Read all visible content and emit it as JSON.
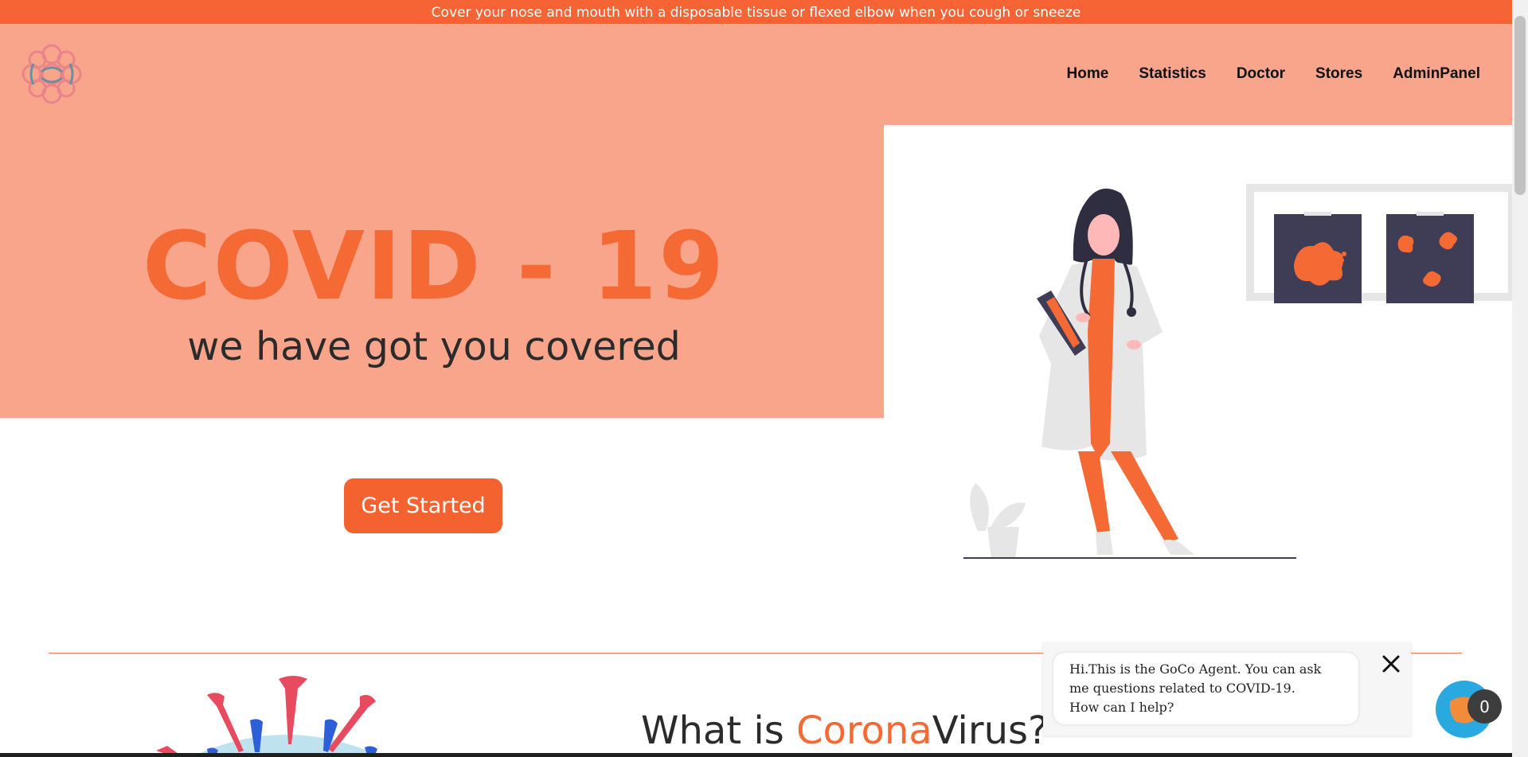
{
  "banner": {
    "text": "Cover your nose and mouth with a disposable tissue or flexed elbow when you cough or sneeze"
  },
  "header": {
    "logo_icon": "virus-logo-icon",
    "nav": [
      "Home",
      "Statistics",
      "Doctor",
      "Stores",
      "AdminPanel"
    ]
  },
  "hero": {
    "title": "COVID - 19",
    "subtitle": "we have got you covered",
    "cta_label": "Get Started"
  },
  "section": {
    "heading_prefix": "What is ",
    "heading_accent": "Corona",
    "heading_suffix": "Virus?"
  },
  "chat": {
    "lines": [
      "Hi.This is the GoCo Agent. You can ask",
      "me questions related to COVID-19.",
      "How can I help?"
    ],
    "badge_count": "0"
  },
  "colors": {
    "accent": "#f56a34",
    "banner": "#f66436",
    "header_bg": "#f9a58c",
    "chat_launcher": "#2aa9e0"
  }
}
